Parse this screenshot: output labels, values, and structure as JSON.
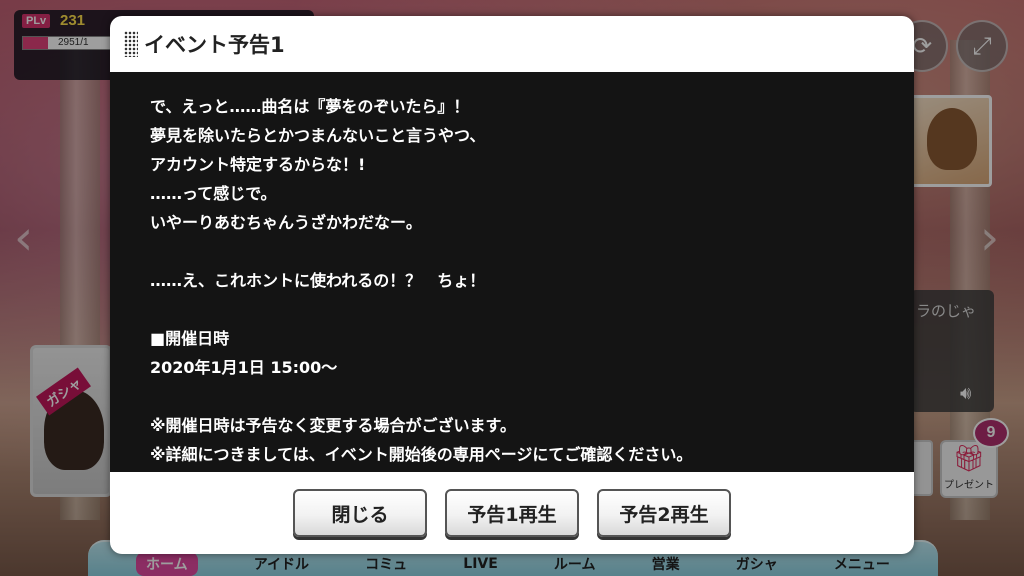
{
  "player": {
    "level_tag": "PLv",
    "level": "231",
    "exp_text": "2951/1",
    "exp_progress": 0.26
  },
  "modal": {
    "title": "イベント予告1",
    "body_lines": [
      "で、えっと……曲名は『夢をのぞいたら』！",
      "夢見を除いたらとかつまんないこと言うやつ、",
      "アカウント特定するからな！!",
      "……って感じで。",
      "いやーりあむちゃんうざかわだなー。",
      "",
      "……え、これホントに使われるの！？　ちょ！",
      "",
      "■開催日時",
      "2020年1月1日 15:00〜",
      "",
      "※開催日時は予告なく変更する場合がございます。",
      "※詳細につきましては、イベント開始後の専用ページにてご確認ください。"
    ],
    "buttons": {
      "close": "閉じる",
      "preview1": "予告1再生",
      "preview2": "予告2再生"
    }
  },
  "background": {
    "gacha_label": "ガシャ",
    "speech_text": "ラのじゃ",
    "present_label": "プレゼント",
    "present_count": "9"
  },
  "nav": {
    "items": [
      "ホーム",
      "アイドル",
      "コミュ",
      "LIVE",
      "ルーム",
      "営業",
      "ガシャ",
      "メニュー"
    ]
  },
  "icons": {
    "rotate": "rotate-icon",
    "fullscreen": "fullscreen-icon",
    "speaker": "speaker-icon",
    "present": "gift-icon"
  },
  "colors": {
    "accent": "#d6336c",
    "level": "#ffe14d",
    "modal_body_bg": "#141414"
  }
}
